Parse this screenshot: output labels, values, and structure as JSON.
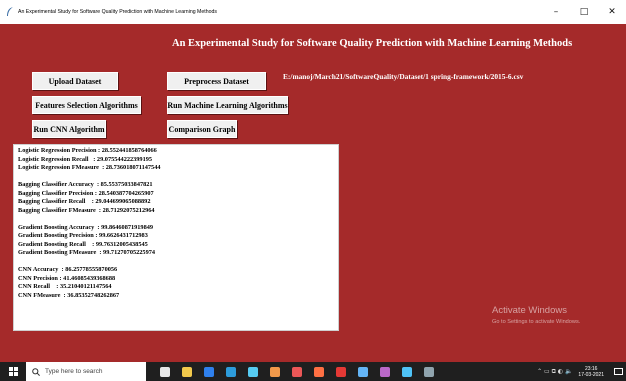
{
  "window": {
    "title": "An Experimental Study for Software Quality Prediction with Machine Learning Methods",
    "controls": {
      "minimize": "–",
      "maximize": "□",
      "close": "✕"
    }
  },
  "app": {
    "heading": "An Experimental Study for Software Quality Prediction with Machine Learning Methods",
    "buttons": {
      "upload": "Upload Dataset",
      "preprocess": "Preprocess Dataset",
      "features": "Features Selection Algorithms",
      "run_ml": "Run Machine Learning Algorithms",
      "run_cnn": "Run CNN Algorithm",
      "comparison": "Comparison Graph"
    },
    "dataset_path": "E:/manoj/March21/SoftwareQuality/Dataset/1 spring-framework/2015-6.csv"
  },
  "results": {
    "lines": [
      "Logistic Regression Precision : 28.552441858764066",
      "Logistic Regression Recall   : 29.075544222399195",
      "Logistic Regression FMeasure  : 28.736018071147544",
      "",
      "Bagging Classifier Accuracy  : 85.55375033847821",
      "Bagging Classifier Precision : 28.540387704265907",
      "Bagging Classifier Recall    : 29.044699065088892",
      "Bagging Classifier FMeasure  : 28.71292075212964",
      "",
      "Gradient Boosting Accuracy  : 99.86460871919849",
      "Gradient Boosting Precision : 99.6626431712983",
      "Gradient Boosting Recall    : 99.76312005438545",
      "Gradient Boosting FMeasure  : 99.71270705225974",
      "",
      "CNN Accuracy  : 86.25778555870056",
      "CNN Precision : 41.46085439368688",
      "CNN Recall    : 35.21040121147564",
      "CNN FMeasure  : 36.85352748262867"
    ]
  },
  "watermark": {
    "line1": "Activate Windows",
    "line2": "Go to Settings to activate Windows."
  },
  "taskbar": {
    "search_placeholder": "Type here to search",
    "clock_time": "23:16",
    "clock_date": "17-03-2021",
    "icons": [
      {
        "name": "task-view-icon",
        "color": "#e6e6e6"
      },
      {
        "name": "file-explorer-icon",
        "color": "#f2c94c"
      },
      {
        "name": "store-icon",
        "color": "#2f80ed"
      },
      {
        "name": "edge-icon",
        "color": "#2d9cdb"
      },
      {
        "name": "notepad-icon",
        "color": "#56ccf2"
      },
      {
        "name": "python-icon",
        "color": "#f2994a"
      },
      {
        "name": "chrome-icon",
        "color": "#eb5757"
      },
      {
        "name": "app-icon-1",
        "color": "#ff7043"
      },
      {
        "name": "app-icon-2",
        "color": "#e53935"
      },
      {
        "name": "app-icon-3",
        "color": "#64b5f6"
      },
      {
        "name": "app-icon-4",
        "color": "#ba68c8"
      },
      {
        "name": "app-icon-5",
        "color": "#4fc3f7"
      },
      {
        "name": "app-icon-6",
        "color": "#90a4ae"
      }
    ]
  },
  "colors": {
    "background": "#a52a2a",
    "taskbar": "#1f1f1f"
  }
}
